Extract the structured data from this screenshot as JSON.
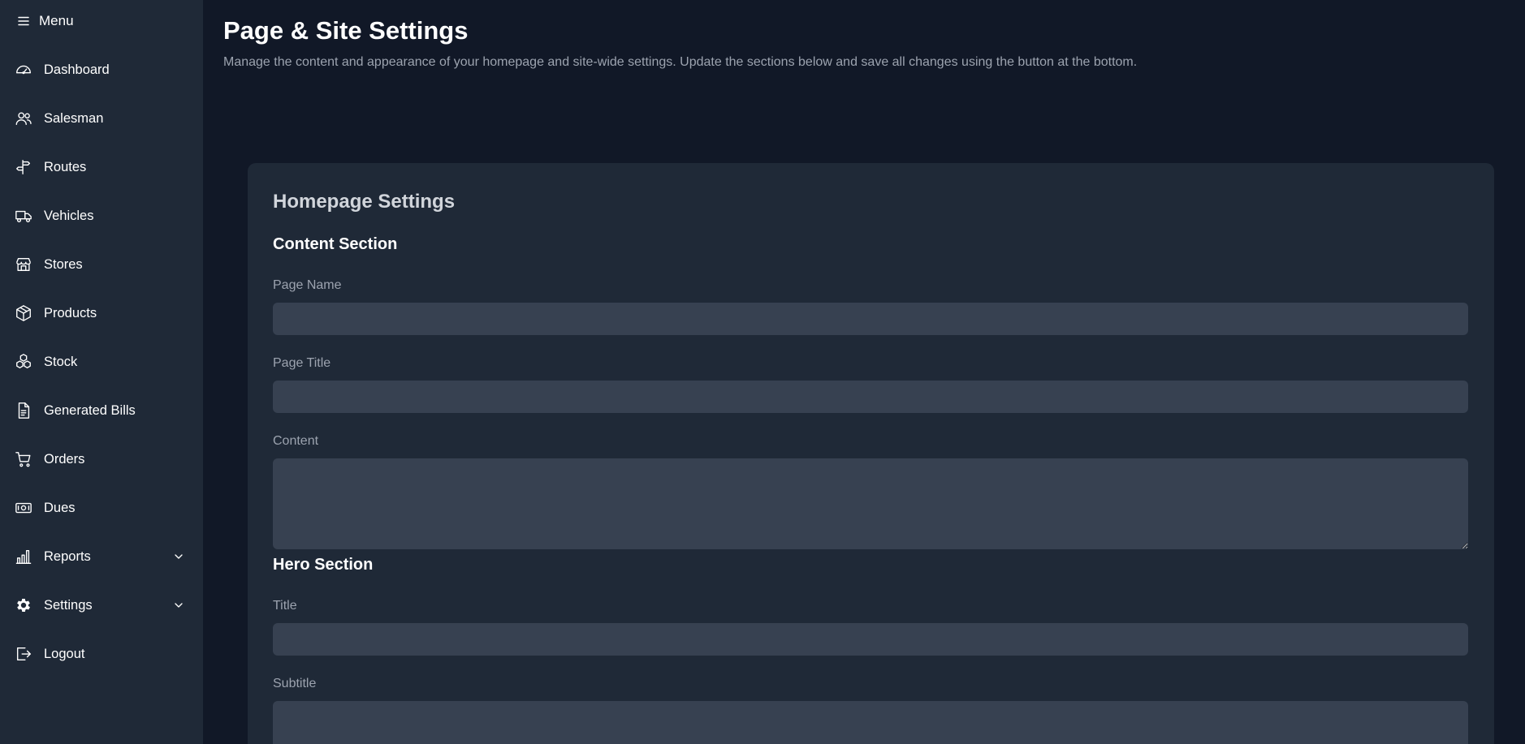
{
  "sidebar": {
    "menu_label": "Menu",
    "items": [
      {
        "label": "Dashboard",
        "icon": "dashboard-gauge-icon"
      },
      {
        "label": "Salesman",
        "icon": "users-icon"
      },
      {
        "label": "Routes",
        "icon": "signpost-icon"
      },
      {
        "label": "Vehicles",
        "icon": "truck-icon"
      },
      {
        "label": "Stores",
        "icon": "store-icon"
      },
      {
        "label": "Products",
        "icon": "box-icon"
      },
      {
        "label": "Stock",
        "icon": "cubes-icon"
      },
      {
        "label": "Generated Bills",
        "icon": "document-icon"
      },
      {
        "label": "Orders",
        "icon": "cart-icon"
      },
      {
        "label": "Dues",
        "icon": "cash-icon"
      },
      {
        "label": "Reports",
        "icon": "bar-chart-icon",
        "expandable": true
      },
      {
        "label": "Settings",
        "icon": "gear-icon",
        "expandable": true
      },
      {
        "label": "Logout",
        "icon": "logout-icon"
      }
    ]
  },
  "header": {
    "title": "Page & Site Settings",
    "description": "Manage the content and appearance of your homepage and site-wide settings. Update the sections below and save all changes using the button at the bottom."
  },
  "card": {
    "title": "Homepage Settings",
    "content_section": {
      "title": "Content Section",
      "page_name_label": "Page Name",
      "page_name_value": "",
      "page_title_label": "Page Title",
      "page_title_value": "",
      "content_label": "Content",
      "content_value": ""
    },
    "hero_section": {
      "title": "Hero Section",
      "title_label": "Title",
      "title_value": "",
      "subtitle_label": "Subtitle",
      "subtitle_value": ""
    }
  },
  "colors": {
    "page_bg": "#111827",
    "sidebar_bg": "#1f2937",
    "card_bg": "#1f2937",
    "input_bg": "#374151",
    "muted_text": "#9ca3af"
  }
}
